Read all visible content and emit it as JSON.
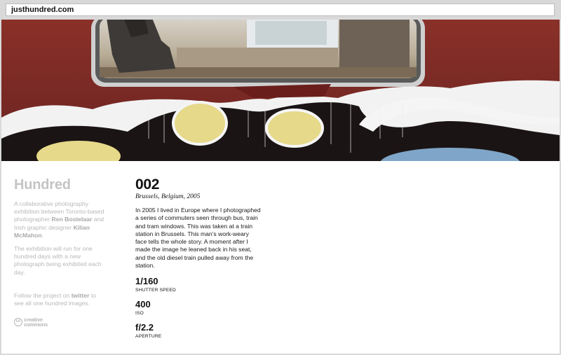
{
  "browser": {
    "url": "justhundred.com"
  },
  "site": {
    "title": "Hundred",
    "intro_pre": "A collaborative photography exhibition between Toronto-based photographer ",
    "photographer": "Ren Bostelaar",
    "intro_mid": " and Irish graphic designer ",
    "designer": "Kilian McMahon",
    "intro_post": ".",
    "note": "The exhibition will run for one hundred days with a new photograph being exhibited each day.",
    "follow_pre": "Follow the project on ",
    "follow_link": "twitter",
    "follow_post": " to see all one hundred images.",
    "license_line1": "creative",
    "license_line2": "commons",
    "license_symbol": "cc"
  },
  "photo": {
    "number": "002",
    "location": "Brussels, Belgium, 2005",
    "story": "In 2005 I lived in Europe where I photographed a series of commuters seen through bus, train and tram windows. This was taken at a train station in Brussels. This man's work-weary face tells the whole story. A moment after I made the image he leaned back in his seat, and the old diesel train pulled away from the station.",
    "stats": [
      {
        "value": "1/160",
        "label": "SHUTTER SPEED"
      },
      {
        "value": "400",
        "label": "ISO"
      },
      {
        "value": "f/2.2",
        "label": "APERTURE"
      }
    ]
  },
  "colors": {
    "train_red": "#7a2a24",
    "graffiti_yellow": "#e6d98a",
    "graffiti_black": "#1b1414",
    "graffiti_blue": "#7fa6c8",
    "title_gray": "#c4c4c4"
  }
}
